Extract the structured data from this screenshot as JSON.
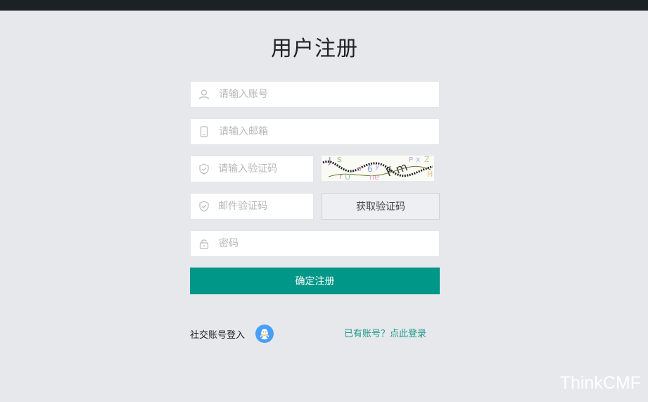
{
  "page": {
    "title": "用户注册",
    "watermark": "ThinkCMF"
  },
  "form": {
    "account": {
      "placeholder": "请输入账号",
      "icon": "user-icon"
    },
    "email": {
      "placeholder": "请输入邮箱",
      "icon": "phone-icon"
    },
    "captcha": {
      "placeholder": "请输入验证码",
      "icon": "shield-icon"
    },
    "mail_code": {
      "placeholder": "邮件验证码",
      "icon": "shield-icon"
    },
    "password": {
      "placeholder": "密码",
      "icon": "lock-icon"
    },
    "get_code_label": "获取验证码",
    "submit_label": "确定注册"
  },
  "footer": {
    "social_label": "社交账号登入",
    "social_icon": "qq-icon",
    "login_link": "已有账号？点此登录"
  },
  "colors": {
    "primary": "#009688",
    "link": "#1a9a8b",
    "qq": "#4b9ef6",
    "topbar": "#1c2126",
    "background": "#e7e8eb"
  }
}
